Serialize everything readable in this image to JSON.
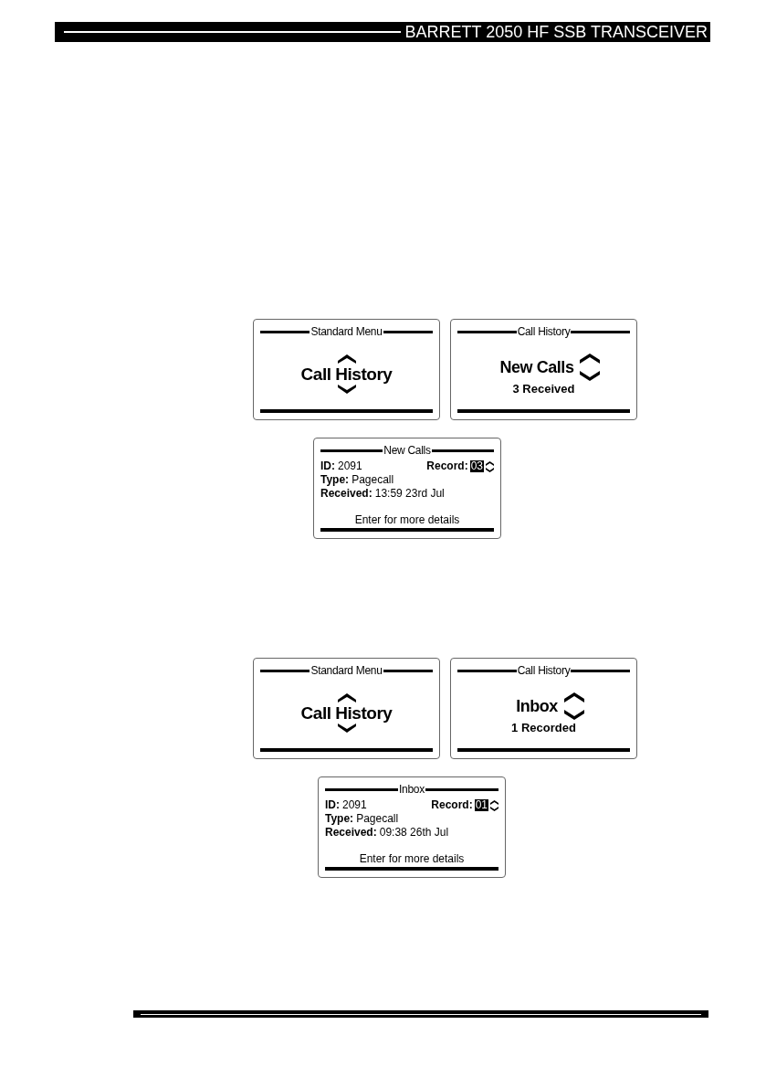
{
  "header": {
    "title": "BARRETT 2050 HF SSB TRANSCEIVER"
  },
  "sections": [
    {
      "screens": [
        {
          "kind": "menu",
          "title": "Standard Menu",
          "item": "Call History"
        },
        {
          "kind": "list",
          "title": "Call History",
          "item": "New Calls",
          "count": "3 Received"
        }
      ],
      "detail_screen": {
        "title": "New Calls",
        "id": {
          "label": "ID:",
          "value": "2091"
        },
        "record": {
          "label": "Record:",
          "value": "03"
        },
        "fields": [
          {
            "label": "Type:",
            "value": "Pagecall"
          },
          {
            "label": "Received:",
            "value": "13:59 23rd Jul"
          }
        ],
        "hint": "Enter for more details"
      }
    },
    {
      "screens": [
        {
          "kind": "menu",
          "title": "Standard Menu",
          "item": "Call History"
        },
        {
          "kind": "list",
          "title": "Call History",
          "item": "Inbox",
          "count": "1 Recorded"
        }
      ],
      "detail_screen": {
        "title": "Inbox",
        "id": {
          "label": "ID:",
          "value": "2091"
        },
        "record": {
          "label": "Record:",
          "value": "01"
        },
        "fields": [
          {
            "label": "Type:",
            "value": "Pagecall"
          },
          {
            "label": "Received:",
            "value": "09:38 26th Jul"
          }
        ],
        "hint": "Enter for more details"
      }
    }
  ]
}
